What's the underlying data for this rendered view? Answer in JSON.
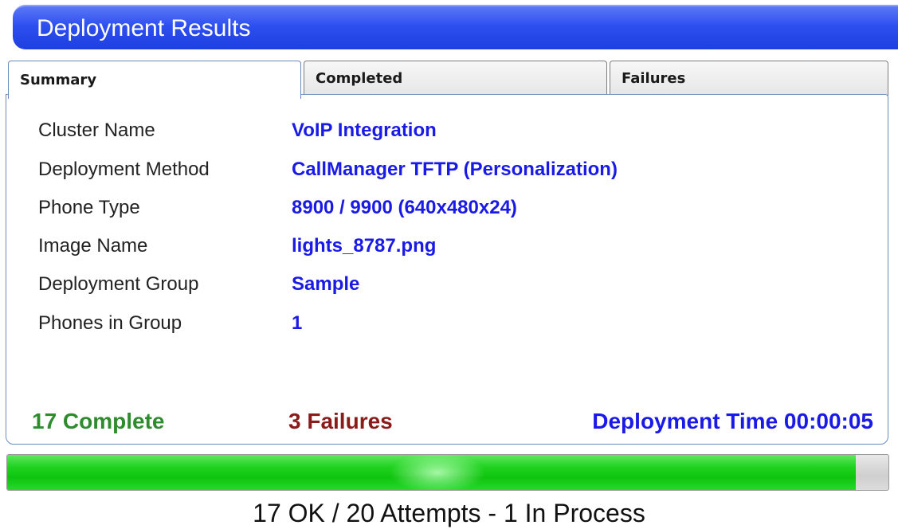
{
  "window": {
    "title": "Deployment Results"
  },
  "tabs": [
    {
      "label": "Summary",
      "active": true
    },
    {
      "label": "Completed",
      "active": false
    },
    {
      "label": "Failures",
      "active": false
    }
  ],
  "summary": {
    "fields": [
      {
        "label": "Cluster Name",
        "value": "VoIP Integration"
      },
      {
        "label": "Deployment Method",
        "value": "CallManager TFTP (Personalization)"
      },
      {
        "label": "Phone Type",
        "value": "8900 / 9900 (640x480x24)"
      },
      {
        "label": "Image Name",
        "value": "lights_8787.png"
      },
      {
        "label": "Deployment Group",
        "value": "Sample"
      },
      {
        "label": "Phones in Group",
        "value": "1"
      }
    ],
    "complete_text": "17 Complete",
    "failures_text": "3 Failures",
    "deployment_time_text": "Deployment Time 00:00:05"
  },
  "progress": {
    "fraction": 0.963,
    "caption": "17 OK / 20 Attempts - 1 In Process"
  },
  "colors": {
    "title_bar": "#2d4ff0",
    "value_text": "#1a1ae6",
    "complete": "#2e8b2e",
    "failures": "#8b1a1a",
    "deployment_time": "#1a1ae6",
    "progress_fill": "#1fd21f"
  }
}
